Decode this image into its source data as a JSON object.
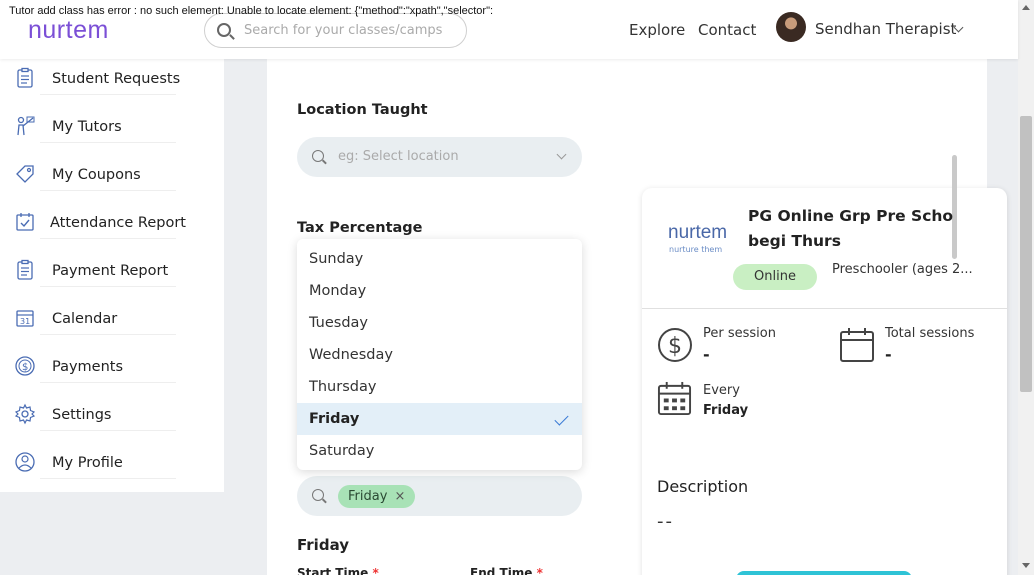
{
  "error_message": "Tutor add class has error : no such element: Unable to locate element: {\"method\":\"xpath\",\"selector\":",
  "header": {
    "logo": "nurtem",
    "search_placeholder": "Search for your classes/camps",
    "nav": [
      "Explore",
      "Contact"
    ],
    "user_name": "Sendhan Therapist"
  },
  "sidebar": {
    "items": [
      {
        "label": "Student Requests",
        "icon": "clipboard-icon"
      },
      {
        "label": "My Tutors",
        "icon": "teacher-icon"
      },
      {
        "label": "My Coupons",
        "icon": "tag-icon"
      },
      {
        "label": "Attendance Report",
        "icon": "calendar-check-icon"
      },
      {
        "label": "Payment Report",
        "icon": "clipboard-icon"
      },
      {
        "label": "Calendar",
        "icon": "calendar-icon"
      },
      {
        "label": "Payments",
        "icon": "dollar-circle-icon"
      },
      {
        "label": "Settings",
        "icon": "gear-icon"
      },
      {
        "label": "My Profile",
        "icon": "user-icon"
      }
    ]
  },
  "form": {
    "location_label": "Location Taught",
    "location_placeholder": "eg: Select location",
    "tax_label": "Tax Percentage",
    "day_options": [
      "Sunday",
      "Monday",
      "Tuesday",
      "Wednesday",
      "Thursday",
      "Friday",
      "Saturday"
    ],
    "selected_day": "Friday",
    "selected_chip": "Friday",
    "day_heading": "Friday",
    "start_time_label": "Start Time",
    "end_time_label": "End Time",
    "required_mark": "*"
  },
  "preview": {
    "logo": "nurtem",
    "logo_sub": "nurture them",
    "title": "PG Online Grp Pre Scho begi Thurs",
    "badge": "Online",
    "age_group": "Preschooler (ages 2...",
    "per_session_label": "Per session",
    "per_session_value": "-",
    "total_sessions_label": "Total sessions",
    "total_sessions_value": "-",
    "every_label": "Every",
    "every_value": "Friday",
    "description_label": "Description",
    "description_value": "--"
  },
  "colors": {
    "accent_blue": "#3a7bd5",
    "chip_green": "#a8e2b6",
    "badge_green": "#c9efc3",
    "button_teal": "#2ec3d6"
  }
}
